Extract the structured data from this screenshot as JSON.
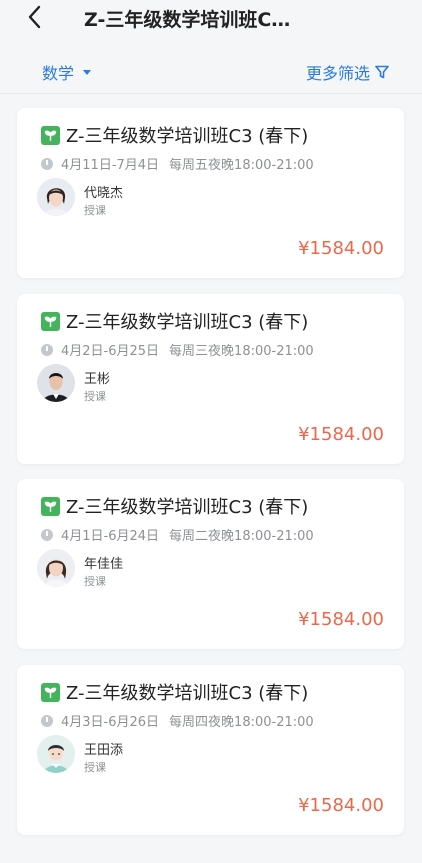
{
  "header": {
    "title": "Z-三年级数学培训班C…"
  },
  "filters": {
    "subject_label": "数学",
    "more_label": "更多筛选"
  },
  "courses": [
    {
      "title": "Z-三年级数学培训班C3 (春下)",
      "dates": "4月11日-7月4日",
      "schedule": "每周五夜晚18:00-21:00",
      "teacher": "代晓杰",
      "role": "授课",
      "price": "¥1584.00"
    },
    {
      "title": "Z-三年级数学培训班C3 (春下)",
      "dates": "4月2日-6月25日",
      "schedule": "每周三夜晚18:00-21:00",
      "teacher": "王彬",
      "role": "授课",
      "price": "¥1584.00"
    },
    {
      "title": "Z-三年级数学培训班C3 (春下)",
      "dates": "4月1日-6月24日",
      "schedule": "每周二夜晚18:00-21:00",
      "teacher": "年佳佳",
      "role": "授课",
      "price": "¥1584.00"
    },
    {
      "title": "Z-三年级数学培训班C3 (春下)",
      "dates": "4月3日-6月26日",
      "schedule": "每周四夜晚18:00-21:00",
      "teacher": "王田添",
      "role": "授课",
      "price": "¥1584.00"
    }
  ],
  "colors": {
    "accent": "#2a7ae2",
    "price": "#f0664a",
    "badge": "#43b45c"
  }
}
